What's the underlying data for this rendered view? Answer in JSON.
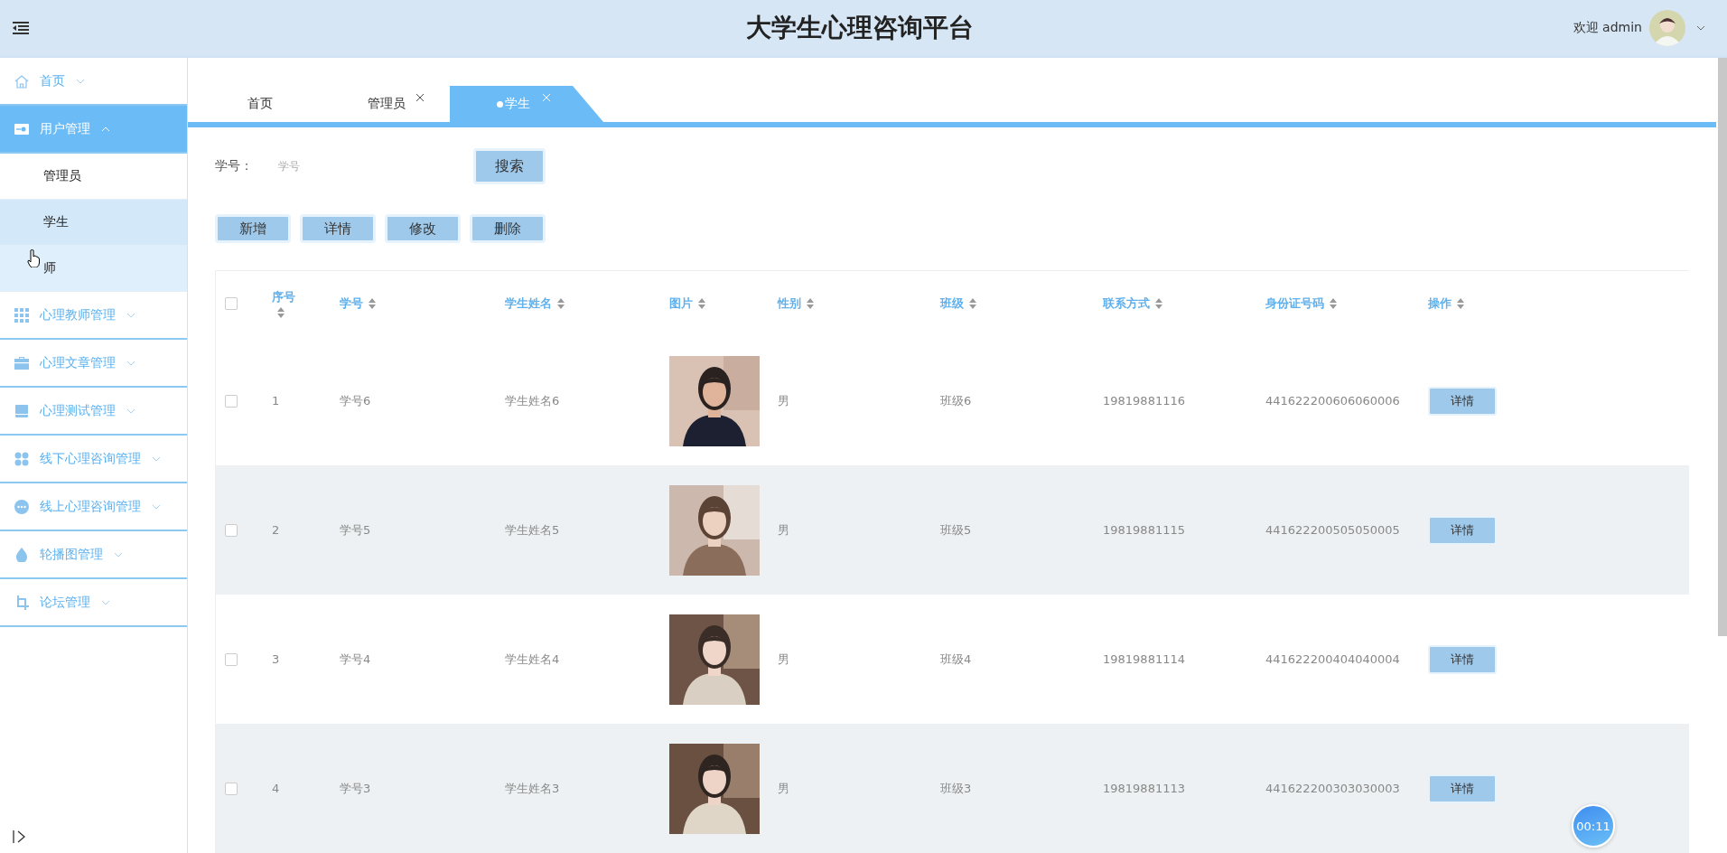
{
  "header": {
    "title": "大学生心理咨询平台",
    "welcome": "欢迎 admin"
  },
  "sidebar": {
    "items": [
      {
        "label": "首页",
        "selected": false,
        "expanded": false
      },
      {
        "label": "用户管理",
        "selected": true,
        "expanded": true,
        "children": [
          {
            "label": "管理员",
            "selected": false,
            "hovered": false
          },
          {
            "label": "学生",
            "selected": true,
            "hovered": false
          },
          {
            "label": "师",
            "selected": false,
            "hovered": true
          }
        ]
      },
      {
        "label": "心理教师管理",
        "selected": false,
        "expanded": false
      },
      {
        "label": "心理文章管理",
        "selected": false,
        "expanded": false
      },
      {
        "label": "心理测试管理",
        "selected": false,
        "expanded": false
      },
      {
        "label": "线下心理咨询管理",
        "selected": false,
        "expanded": false
      },
      {
        "label": "线上心理咨询管理",
        "selected": false,
        "expanded": false
      },
      {
        "label": "轮播图管理",
        "selected": false,
        "expanded": false
      },
      {
        "label": "论坛管理",
        "selected": false,
        "expanded": false
      }
    ]
  },
  "tabs": [
    {
      "label": "首页",
      "selected": false,
      "closable": false
    },
    {
      "label": "管理员",
      "selected": false,
      "closable": true
    },
    {
      "label": "学生",
      "selected": true,
      "closable": true
    }
  ],
  "search": {
    "label": "学号：",
    "placeholder": "学号",
    "button": "搜索"
  },
  "actions": [
    "新增",
    "详情",
    "修改",
    "删除"
  ],
  "table": {
    "select_all": {
      "checked": false
    },
    "columns": [
      "序号",
      "学号",
      "学生姓名",
      "图片",
      "性别",
      "班级",
      "联系方式",
      "身份证号码",
      "操作"
    ],
    "rows": [
      {
        "checked": false,
        "cells": [
          "1",
          "学号6",
          "学生姓名6",
          {
            "kind": "picture"
          },
          "男",
          "班级6",
          "19819881116",
          "441622200606060006"
        ],
        "action": "详情"
      },
      {
        "checked": false,
        "cells": [
          "2",
          "学号5",
          "学生姓名5",
          {
            "kind": "picture"
          },
          "男",
          "班级5",
          "19819881115",
          "441622200505050005"
        ],
        "action": "详情"
      },
      {
        "checked": false,
        "cells": [
          "3",
          "学号4",
          "学生姓名4",
          {
            "kind": "picture"
          },
          "男",
          "班级4",
          "19819881114",
          "441622200404040004"
        ],
        "action": "详情"
      },
      {
        "checked": false,
        "cells": [
          "4",
          "学号3",
          "学生姓名3",
          {
            "kind": "picture"
          },
          "男",
          "班级3",
          "19819881113",
          "441622200303030003"
        ],
        "action": "详情"
      }
    ]
  },
  "timer": "00:11"
}
